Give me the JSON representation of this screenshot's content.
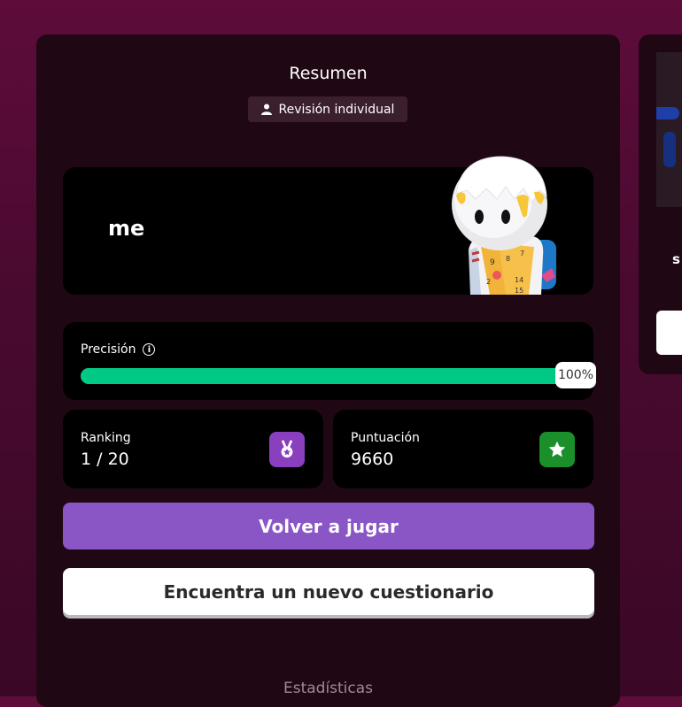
{
  "summary": {
    "title": "Resumen",
    "badge_label": "Revisión individual"
  },
  "player": {
    "name": "me"
  },
  "accuracy": {
    "label": "Precisión",
    "value_text": "100%",
    "fraction": 1.0
  },
  "ranking": {
    "label": "Ranking",
    "value": "1 / 20"
  },
  "score": {
    "label": "Puntuación",
    "value": "9660"
  },
  "actions": {
    "play_again": "Volver a jugar",
    "find_quiz": "Encuentra un nuevo cuestionario"
  },
  "stats_section": {
    "title": "Estadísticas"
  },
  "side_panel": {
    "text": "s"
  },
  "colors": {
    "accuracy_fill": "#00c985",
    "ranking_icon_bg": "#8a3fbf",
    "score_icon_bg": "#1a8f2a",
    "play_button": "#8a55c4"
  }
}
